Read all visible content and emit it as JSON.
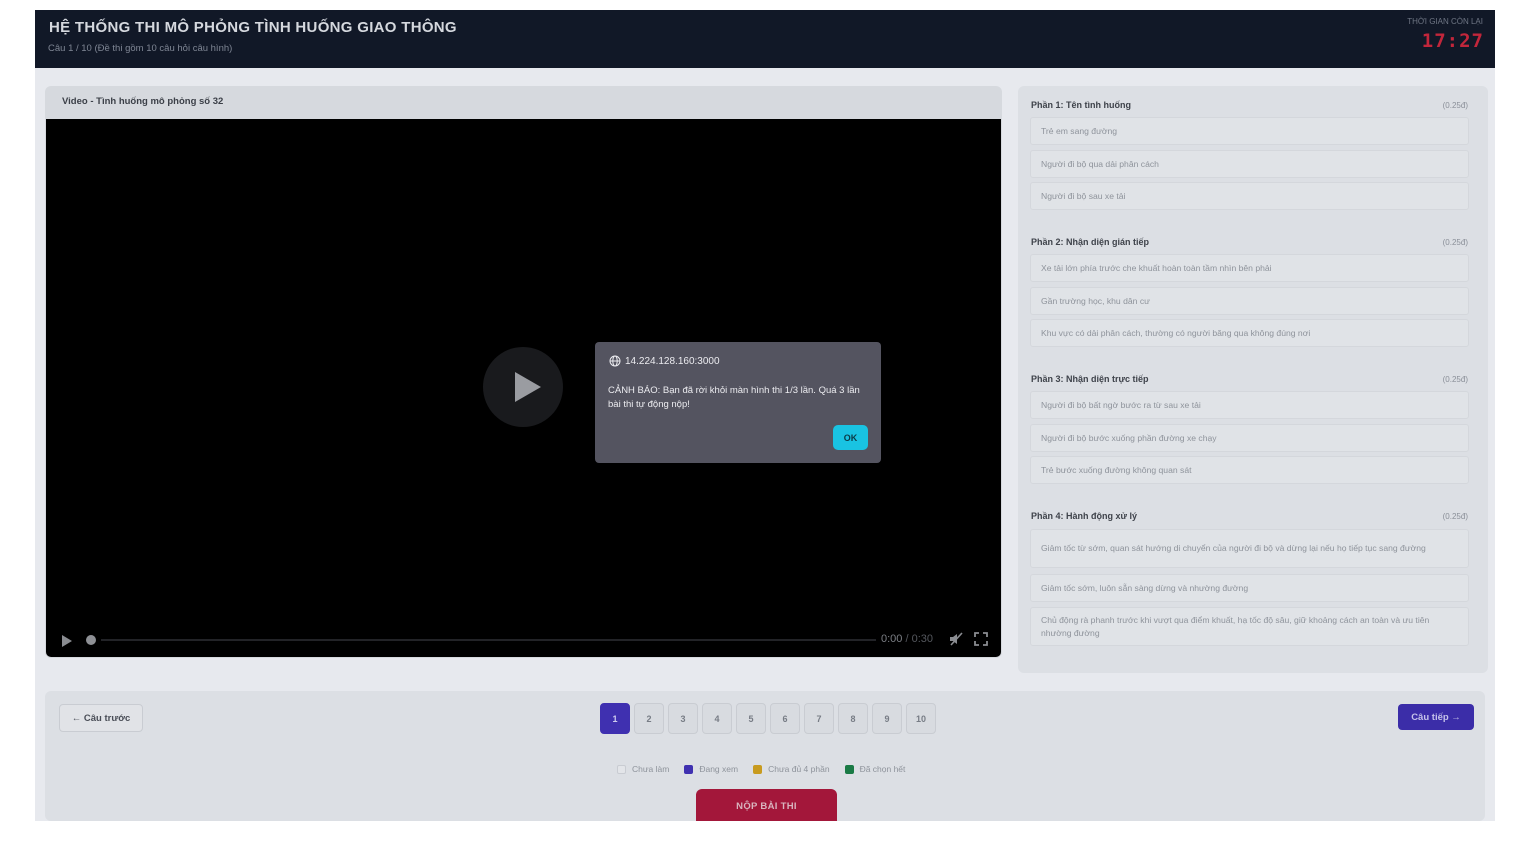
{
  "header": {
    "title": "HỆ THỐNG THI MÔ PHỎNG TÌNH HUỐNG GIAO THÔNG",
    "subtitle": "Câu 1 / 10 (Đề thi gồm 10 câu hỏi câu hình)",
    "timer_label": "THỜI GIAN CÒN LẠI",
    "timer": "17:27"
  },
  "video": {
    "title": "Video - Tình huống mô phỏng số 32",
    "current_time": "0:00",
    "separator": "/",
    "total_time": "0:30"
  },
  "sections": [
    {
      "title": "Phần 1: Tên tình huống",
      "points": "(0.25đ)",
      "options": [
        "Trẻ em sang đường",
        "Người đi bộ qua dải phân cách",
        "Người đi bộ sau xe tải"
      ]
    },
    {
      "title": "Phần 2: Nhận diện gián tiếp",
      "points": "(0.25đ)",
      "options": [
        "Xe tải lớn phía trước che khuất hoàn toàn tầm nhìn bên phải",
        "Gần trường học, khu dân cư",
        "Khu vực có dải phân cách, thường có người băng qua không đúng nơi"
      ]
    },
    {
      "title": "Phần 3: Nhận diện trực tiếp",
      "points": "(0.25đ)",
      "options": [
        "Người đi bộ bất ngờ bước ra từ sau xe tải",
        "Người đi bộ bước xuống phần đường xe chạy",
        "Trẻ bước xuống đường không quan sát"
      ]
    },
    {
      "title": "Phần 4: Hành động xử lý",
      "points": "(0.25đ)",
      "options": [
        "Giảm tốc từ sớm, quan sát hướng di chuyển của người đi bộ và dừng lại nếu họ tiếp tục sang đường",
        "Giảm tốc sớm, luôn sẵn sàng dừng và nhường đường",
        "Chủ động rà phanh trước khi vượt qua điểm khuất, hạ tốc độ sâu, giữ khoảng cách an toàn và ưu tiên nhường đường"
      ]
    }
  ],
  "navigation": {
    "prev_label": "← Câu trước",
    "next_label": "Câu tiếp →",
    "pages": [
      "1",
      "2",
      "3",
      "4",
      "5",
      "6",
      "7",
      "8",
      "9",
      "10"
    ],
    "active_page": "1",
    "legend": [
      {
        "label": "Chưa làm",
        "color": "#e3e5e9"
      },
      {
        "label": "Đang xem",
        "color": "#3f30b0"
      },
      {
        "label": "Chưa đủ 4 phần",
        "color": "#c89b1f"
      },
      {
        "label": "Đã chọn hết",
        "color": "#1a7a45"
      }
    ],
    "submit_label": "NỘP BÀI THI"
  },
  "dialog": {
    "origin": "14.224.128.160:3000",
    "message": "CẢNH BÁO: Bạn đã rời khỏi màn hình thi 1/3 lần. Quá 3 lần bài thi tự động nộp!",
    "ok_label": "OK"
  },
  "colors": {
    "header_bg": "#111827",
    "timer": "#c2263b",
    "primary": "#3f30b0",
    "submit": "#a3173a",
    "ok_button": "#19c3e2"
  }
}
